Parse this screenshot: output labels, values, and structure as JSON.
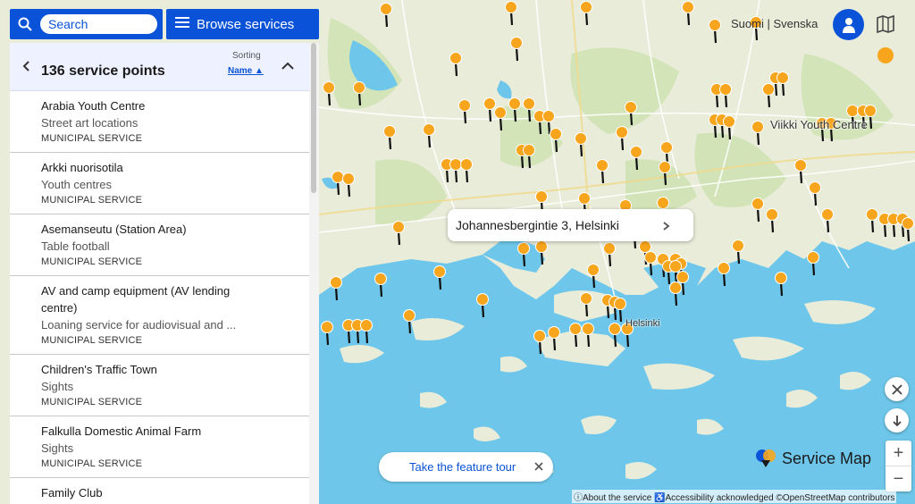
{
  "search": {
    "placeholder": "Search"
  },
  "browse": {
    "label": "Browse services"
  },
  "results": {
    "count_label": "136 service points",
    "sorting_label": "Sorting",
    "sort_value": "Name ▲"
  },
  "items": [
    {
      "name": "Arabia Youth Centre",
      "category": "Street art locations",
      "type": "MUNICIPAL SERVICE"
    },
    {
      "name": "Arkki nuorisotila",
      "category": "Youth centres",
      "type": "MUNICIPAL SERVICE"
    },
    {
      "name": "Asemanseutu (Station Area)",
      "category": "Table football",
      "type": "MUNICIPAL SERVICE"
    },
    {
      "name": "AV and camp equipment (AV lending centre)",
      "category": "Loaning service for audiovisual and ...",
      "type": "MUNICIPAL SERVICE"
    },
    {
      "name": "Children's Traffic Town",
      "category": "Sights",
      "type": "MUNICIPAL SERVICE"
    },
    {
      "name": "Falkulla Domestic Animal Farm",
      "category": "Sights",
      "type": "MUNICIPAL SERVICE"
    },
    {
      "name": "Family Club",
      "category": "",
      "type": ""
    }
  ],
  "language": {
    "label": "Suomi | Svenska"
  },
  "popup": {
    "address": "Johannesbergintie 3, Helsinki"
  },
  "tour": {
    "label": "Take the feature tour"
  },
  "logo": {
    "text": "Service Map"
  },
  "attribution": {
    "text": "ⓘAbout the service ♿Accessibility acknowledged ©OpenStreetMap contributors"
  },
  "map_labels": {
    "viikki": "Viikki Youth Centre",
    "helsinki": "Helsinki"
  },
  "icons": [
    "search-icon",
    "menu-icon",
    "chevron-left-icon",
    "chevron-up-icon",
    "account-icon",
    "map-icon",
    "location-pin-icon",
    "tools-icon",
    "down-arrow-icon",
    "close-icon",
    "arrow-right-icon"
  ],
  "colors": {
    "brand": "#0a53d8",
    "marker": "#f7a51d",
    "water": "#6ec7ea",
    "land": "#e9ecd9",
    "panel_header": "#eef1ff"
  }
}
